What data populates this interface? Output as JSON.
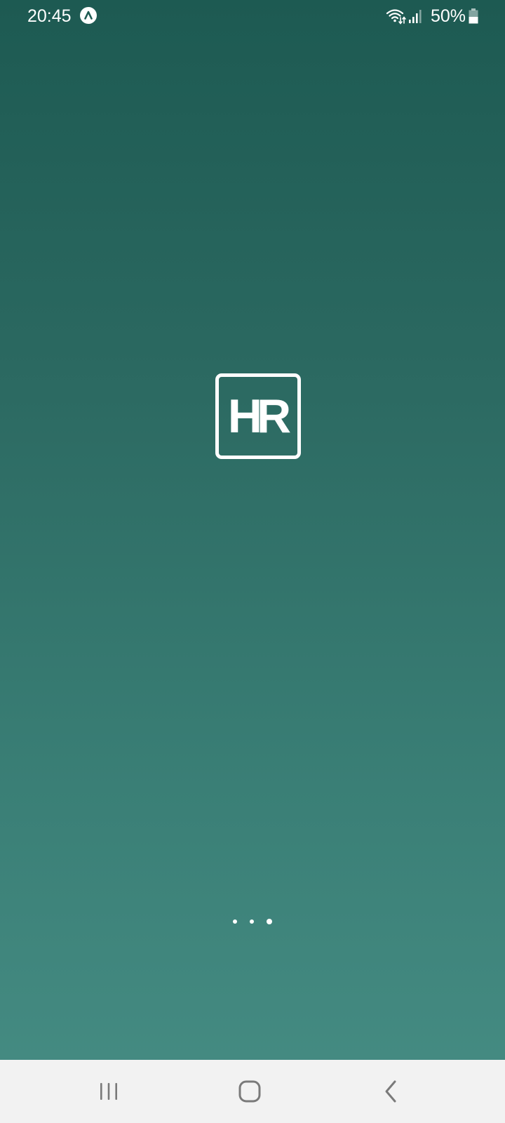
{
  "status_bar": {
    "time": "20:45",
    "app_icon": "android-auto-icon",
    "wifi_icon": "wifi-icon",
    "signal_icon": "cellular-signal-icon",
    "battery_percent": "50%",
    "battery_icon": "battery-icon",
    "battery_level": 0.5
  },
  "splash": {
    "logo_text": "HR",
    "loading_icon": "loading-dots"
  },
  "nav_bar": {
    "recents_icon": "recents-icon",
    "home_icon": "home-icon",
    "back_icon": "back-icon"
  },
  "colors": {
    "background_top": "#1d5a52",
    "background_bottom": "#468d84",
    "foreground": "#ffffff",
    "nav_bar_background": "#f2f2f2",
    "nav_icon": "#7a7a7a"
  }
}
